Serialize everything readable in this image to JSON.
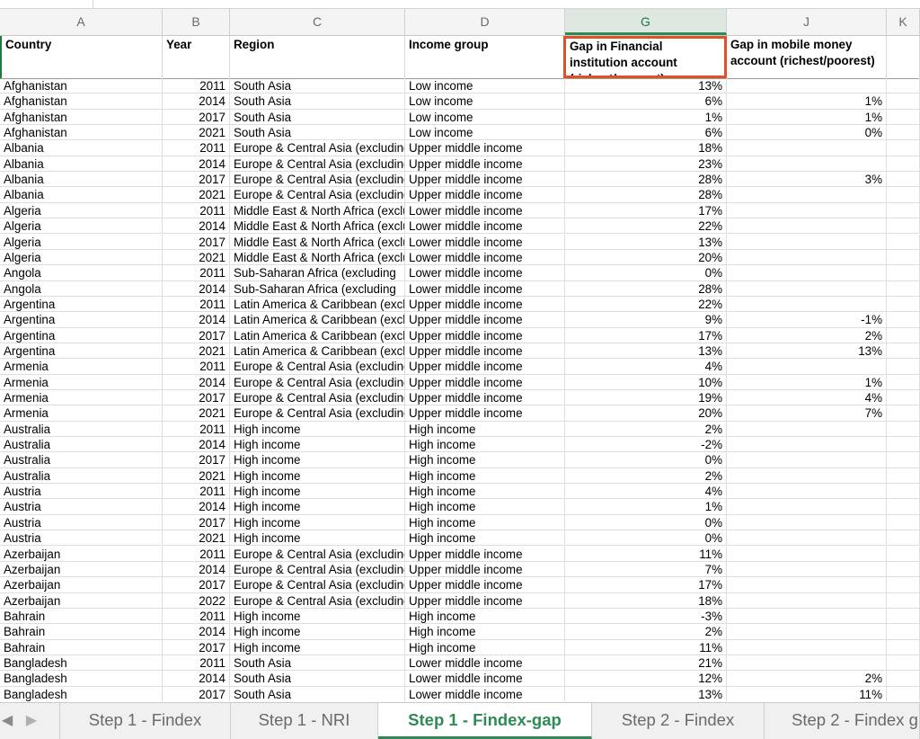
{
  "column_letters": [
    "A",
    "B",
    "C",
    "D",
    "G",
    "J",
    "K"
  ],
  "headers": {
    "country": "Country",
    "year": "Year",
    "region": "Region",
    "income_group": "Income group",
    "gap_fi": "Gap in Financial institution account (richest/poorest)",
    "gap_mm": "Gap in mobile money account (richest/poorest)"
  },
  "rows": [
    [
      "Afghanistan",
      "2011",
      "South Asia",
      "Low income",
      "13%",
      ""
    ],
    [
      "Afghanistan",
      "2014",
      "South Asia",
      "Low income",
      "6%",
      "1%"
    ],
    [
      "Afghanistan",
      "2017",
      "South Asia",
      "Low income",
      "1%",
      "1%"
    ],
    [
      "Afghanistan",
      "2021",
      "South Asia",
      "Low income",
      "6%",
      "0%"
    ],
    [
      "Albania",
      "2011",
      "Europe & Central Asia (excluding",
      "Upper middle income",
      "18%",
      ""
    ],
    [
      "Albania",
      "2014",
      "Europe & Central Asia (excluding",
      "Upper middle income",
      "23%",
      ""
    ],
    [
      "Albania",
      "2017",
      "Europe & Central Asia (excluding",
      "Upper middle income",
      "28%",
      "3%"
    ],
    [
      "Albania",
      "2021",
      "Europe & Central Asia (excluding",
      "Upper middle income",
      "28%",
      ""
    ],
    [
      "Algeria",
      "2011",
      "Middle East & North Africa (excluding",
      "Lower middle income",
      "17%",
      ""
    ],
    [
      "Algeria",
      "2014",
      "Middle East & North Africa (excluding",
      "Lower middle income",
      "22%",
      ""
    ],
    [
      "Algeria",
      "2017",
      "Middle East & North Africa (excluding",
      "Lower middle income",
      "13%",
      ""
    ],
    [
      "Algeria",
      "2021",
      "Middle East & North Africa (excluding",
      "Lower middle income",
      "20%",
      ""
    ],
    [
      "Angola",
      "2011",
      "Sub-Saharan Africa (excluding",
      "Lower middle income",
      "0%",
      ""
    ],
    [
      "Angola",
      "2014",
      "Sub-Saharan Africa (excluding",
      "Lower middle income",
      "28%",
      ""
    ],
    [
      "Argentina",
      "2011",
      "Latin America & Caribbean (excluding",
      "Upper middle income",
      "22%",
      ""
    ],
    [
      "Argentina",
      "2014",
      "Latin America & Caribbean (excluding",
      "Upper middle income",
      "9%",
      "-1%"
    ],
    [
      "Argentina",
      "2017",
      "Latin America & Caribbean (excluding",
      "Upper middle income",
      "17%",
      "2%"
    ],
    [
      "Argentina",
      "2021",
      "Latin America & Caribbean (excluding",
      "Upper middle income",
      "13%",
      "13%"
    ],
    [
      "Armenia",
      "2011",
      "Europe & Central Asia (excluding",
      "Upper middle income",
      "4%",
      ""
    ],
    [
      "Armenia",
      "2014",
      "Europe & Central Asia (excluding",
      "Upper middle income",
      "10%",
      "1%"
    ],
    [
      "Armenia",
      "2017",
      "Europe & Central Asia (excluding",
      "Upper middle income",
      "19%",
      "4%"
    ],
    [
      "Armenia",
      "2021",
      "Europe & Central Asia (excluding",
      "Upper middle income",
      "20%",
      "7%"
    ],
    [
      "Australia",
      "2011",
      "High income",
      "High income",
      "2%",
      ""
    ],
    [
      "Australia",
      "2014",
      "High income",
      "High income",
      "-2%",
      ""
    ],
    [
      "Australia",
      "2017",
      "High income",
      "High income",
      "0%",
      ""
    ],
    [
      "Australia",
      "2021",
      "High income",
      "High income",
      "2%",
      ""
    ],
    [
      "Austria",
      "2011",
      "High income",
      "High income",
      "4%",
      ""
    ],
    [
      "Austria",
      "2014",
      "High income",
      "High income",
      "1%",
      ""
    ],
    [
      "Austria",
      "2017",
      "High income",
      "High income",
      "0%",
      ""
    ],
    [
      "Austria",
      "2021",
      "High income",
      "High income",
      "0%",
      ""
    ],
    [
      "Azerbaijan",
      "2011",
      "Europe & Central Asia (excluding",
      "Upper middle income",
      "11%",
      ""
    ],
    [
      "Azerbaijan",
      "2014",
      "Europe & Central Asia (excluding",
      "Upper middle income",
      "7%",
      ""
    ],
    [
      "Azerbaijan",
      "2017",
      "Europe & Central Asia (excluding",
      "Upper middle income",
      "17%",
      ""
    ],
    [
      "Azerbaijan",
      "2022",
      "Europe & Central Asia (excluding",
      "Upper middle income",
      "18%",
      ""
    ],
    [
      "Bahrain",
      "2011",
      "High income",
      "High income",
      "-3%",
      ""
    ],
    [
      "Bahrain",
      "2014",
      "High income",
      "High income",
      "2%",
      ""
    ],
    [
      "Bahrain",
      "2017",
      "High income",
      "High income",
      "11%",
      ""
    ],
    [
      "Bangladesh",
      "2011",
      "South Asia",
      "Lower middle income",
      "21%",
      ""
    ],
    [
      "Bangladesh",
      "2014",
      "South Asia",
      "Lower middle income",
      "12%",
      "2%"
    ],
    [
      "Bangladesh",
      "2017",
      "South Asia",
      "Lower middle income",
      "13%",
      "11%"
    ]
  ],
  "tabs": [
    "Step 1 - Findex",
    "Step 1 - NRI",
    "Step 1 - Findex-gap",
    "Step 2 - Findex",
    "Step 2 - Findex g"
  ],
  "active_tab": "Step 1 - Findex-gap",
  "colors": {
    "accent": "#2e8b57",
    "highlight_box": "#e2502a"
  }
}
